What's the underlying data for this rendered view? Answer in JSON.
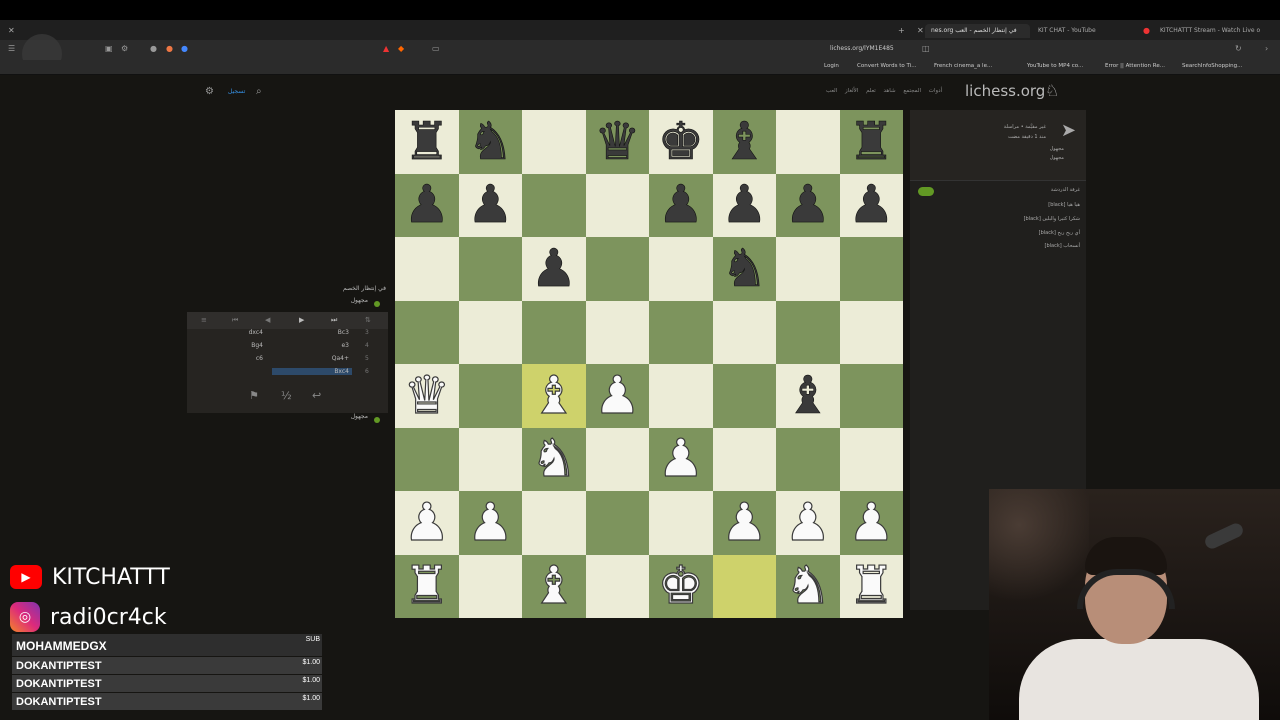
{
  "browser": {
    "tabs": [
      {
        "label": "nes.org في إنتظار الخصم - العب"
      },
      {
        "label": "KIT CHAT - YouTube"
      },
      {
        "label": "KITCHATTT Stream - Watch Live on K"
      }
    ],
    "url": "lichess.org/lYM1E485",
    "bookmarks": [
      "Login",
      "Convert Words to Ti...",
      "French cinema_a le...",
      "YouTube to MP4 co...",
      "Error || Attention Re...",
      "SearchInfoShopping..."
    ]
  },
  "site": {
    "logo": "lichess.org",
    "nav": [
      "العب",
      "الألغاز",
      "تعلم",
      "شاهد",
      "المجتمع",
      "أدوات"
    ],
    "login_link": "تسجيل"
  },
  "game_info": {
    "line1": "غير مقيَّمة • مراسلة",
    "line2": "منذ 1 دقيقة مضت",
    "p1": "مجهول",
    "p2": "مجهول"
  },
  "chat": {
    "title": "غرفة الدردشة",
    "lines": [
      "[black] هيا هيا",
      "[black] شكرا كثيرا والبلين",
      "[black] أي ربح ربح",
      "[black] أنسحاب"
    ]
  },
  "left": {
    "waiting": "في إنتظار الخصم",
    "top_player": "مجهول",
    "bottom_player": "مجهول",
    "moves": [
      {
        "n": "3",
        "w": "Bc3",
        "b": "dxc4"
      },
      {
        "n": "4",
        "w": "e3",
        "b": "Bg4"
      },
      {
        "n": "5",
        "w": "Qa4+",
        "b": "c6"
      },
      {
        "n": "6",
        "w": "Bxc4",
        "b": ""
      }
    ]
  },
  "board": {
    "ranks": [
      [
        "bR",
        "bN",
        "",
        "bQ",
        "bK",
        "bB",
        "",
        "bR"
      ],
      [
        "bP",
        "bP",
        "",
        "",
        "bP",
        "bP",
        "bP",
        "bP"
      ],
      [
        "",
        "",
        "bP",
        "",
        "",
        "bN",
        "",
        ""
      ],
      [
        "",
        "",
        "",
        "",
        "",
        "",
        "",
        ""
      ],
      [
        "wQ",
        "",
        "wB",
        "wP",
        "",
        "",
        "bB",
        ""
      ],
      [
        "",
        "",
        "wN",
        "",
        "wP",
        "",
        "",
        ""
      ],
      [
        "wP",
        "wP",
        "",
        "",
        "",
        "wP",
        "wP",
        "wP"
      ],
      [
        "wR",
        "",
        "wB",
        "",
        "wK",
        "",
        "wN",
        "wR"
      ]
    ],
    "highlights": [
      [
        4,
        2
      ],
      [
        7,
        5
      ]
    ]
  },
  "overlay": {
    "youtube": "KITCHATTT",
    "instagram": "radi0cr4ck",
    "sub_header": "MOHAMMEDGX",
    "sub_tag": "SUB",
    "donations": [
      {
        "name": "DOKANTIPTEST",
        "amount": "$1.00"
      },
      {
        "name": "DOKANTIPTEST",
        "amount": "$1.00"
      },
      {
        "name": "DOKANTIPTEST",
        "amount": "$1.00"
      }
    ]
  }
}
